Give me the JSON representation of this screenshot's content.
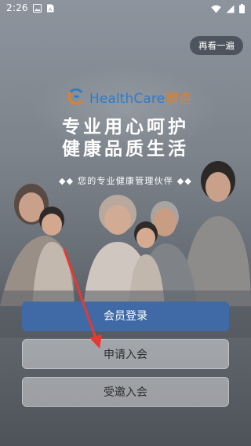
{
  "status_bar": {
    "time": "2:26",
    "left_icons": [
      "photo-icon",
      "sim-card-icon"
    ],
    "right_icons": [
      "wifi-icon",
      "signal-icon",
      "battery-icon"
    ]
  },
  "header": {
    "replay_label": "再看一遍"
  },
  "brand": {
    "name_en": "HealthCare",
    "name_cn": "橙杏",
    "en_color": "#2d7cc9",
    "cn_color": "#e67e22"
  },
  "hero": {
    "line1": "专业用心呵护",
    "line2": "健康品质生活",
    "slogan": "◆◆ 您的专业健康管理伙伴 ◆◆"
  },
  "actions": {
    "login_label": "会员登录",
    "apply_label": "申请入会",
    "invite_label": "受邀入会",
    "primary_color": "#3f6aa6"
  }
}
